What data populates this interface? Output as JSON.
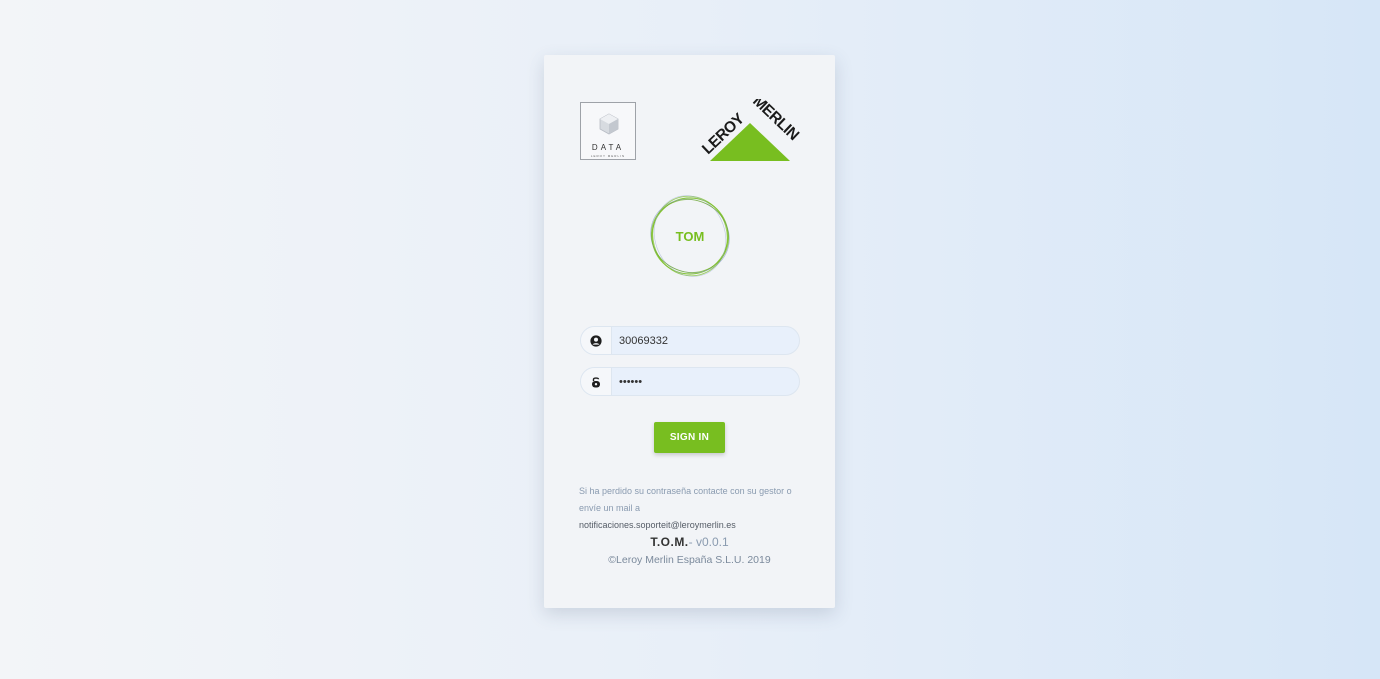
{
  "logos": {
    "data_logo": {
      "word": "DATA",
      "sub": "LEROY MERLIN"
    },
    "brand_logo": {
      "name": "LEROY MERLIN",
      "color": "#78be20"
    },
    "app_logo": {
      "text": "TOM",
      "color": "#78be20"
    }
  },
  "form": {
    "username": {
      "value": "30069332",
      "icon": "user-icon"
    },
    "password": {
      "value": "••••••",
      "icon": "lock-icon"
    },
    "signin_label": "SIGN IN"
  },
  "help": {
    "line": "Si ha perdido su contraseña contacte con su gestor o envíe un mail a",
    "email": "notificaciones.soporteit@leroymerlin.es"
  },
  "footer": {
    "app_name": "T.O.M.",
    "version": "- v0.0.1",
    "copyright": "©Leroy Merlin España S.L.U. 2019"
  },
  "colors": {
    "accent": "#78be20",
    "card_bg": "#f2f4f7",
    "input_bg": "#e8f0fb"
  }
}
